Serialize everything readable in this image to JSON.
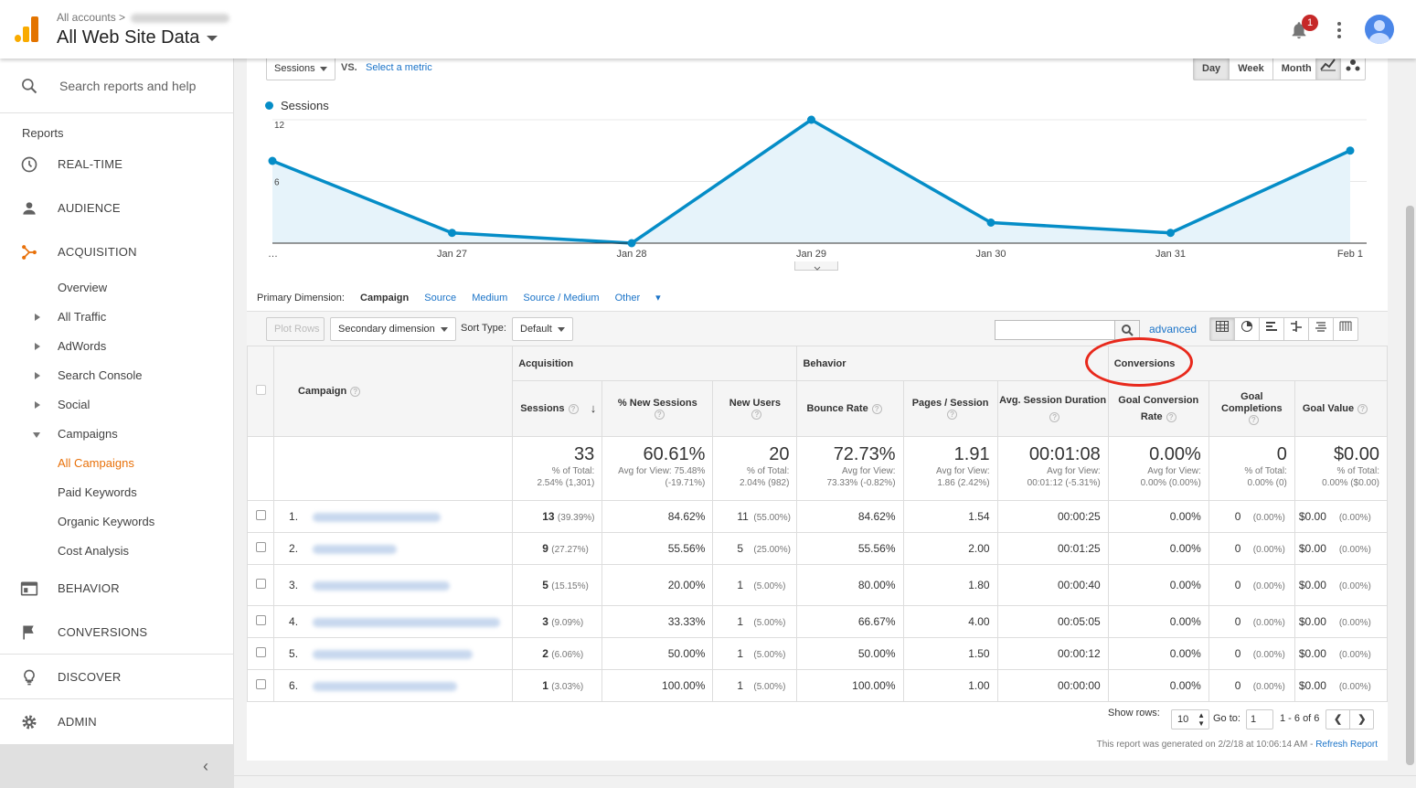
{
  "header": {
    "crumb": "All accounts",
    "view": "All Web Site Data",
    "notifications": "1"
  },
  "sidebar": {
    "search_placeholder": "Search reports and help",
    "reports": "Reports",
    "main": {
      "realtime": "REAL-TIME",
      "audience": "AUDIENCE",
      "acquisition": "ACQUISITION",
      "behavior": "BEHAVIOR",
      "conversions": "CONVERSIONS",
      "discover": "DISCOVER",
      "admin": "ADMIN"
    },
    "sub": {
      "overview": "Overview",
      "all_traffic": "All Traffic",
      "adwords": "AdWords",
      "search_console": "Search Console",
      "social": "Social",
      "campaigns": "Campaigns",
      "all_campaigns": "All Campaigns",
      "paid_keywords": "Paid Keywords",
      "organic_keywords": "Organic Keywords",
      "cost_analysis": "Cost Analysis"
    }
  },
  "controls": {
    "metric": "Sessions",
    "vs": "VS.",
    "select_metric": "Select a metric",
    "day": "Day",
    "week": "Week",
    "month": "Month"
  },
  "chart_data": {
    "type": "area",
    "series": [
      {
        "name": "Sessions",
        "values": [
          8,
          1,
          0,
          12,
          2,
          1,
          9
        ]
      }
    ],
    "x": [
      "…",
      "Jan 27",
      "Jan 28",
      "Jan 29",
      "Jan 30",
      "Jan 31",
      "Feb 1"
    ],
    "yticks": [
      "12",
      "6"
    ],
    "ylim": [
      0,
      12
    ],
    "color": "#058dc7"
  },
  "dims": {
    "label": "Primary Dimension:",
    "campaign": "Campaign",
    "source": "Source",
    "medium": "Medium",
    "source_medium": "Source / Medium",
    "other": "Other"
  },
  "toolbar": {
    "plot_rows": "Plot Rows",
    "secondary": "Secondary dimension",
    "sort_type_label": "Sort Type:",
    "sort_type": "Default",
    "advanced": "advanced"
  },
  "table": {
    "groups": {
      "acquisition": "Acquisition",
      "behavior": "Behavior",
      "conversions": "Conversions"
    },
    "cols": {
      "campaign": "Campaign",
      "sessions": "Sessions",
      "new_sessions": "% New Sessions",
      "new_users": "New Users",
      "bounce": "Bounce Rate",
      "pages": "Pages / Session",
      "duration": "Avg. Session Duration",
      "gcr": "Goal Conversion Rate",
      "gc": "Goal Completions",
      "gv": "Goal Value"
    },
    "totals": [
      {
        "big": "33",
        "sub": "% of Total:",
        "sub2": "2.54% (1,301)"
      },
      {
        "big": "60.61%",
        "sub": "Avg for View: 75.48%",
        "sub2": "(-19.71%)"
      },
      {
        "big": "20",
        "sub": "% of Total:",
        "sub2": "2.04% (982)"
      },
      {
        "big": "72.73%",
        "sub": "Avg for View:",
        "sub2": "73.33% (-0.82%)"
      },
      {
        "big": "1.91",
        "sub": "Avg for View:",
        "sub2": "1.86 (2.42%)"
      },
      {
        "big": "00:01:08",
        "sub": "Avg for View:",
        "sub2": "00:01:12 (-5.31%)"
      },
      {
        "big": "0.00%",
        "sub": "Avg for View:",
        "sub2": "0.00% (0.00%)"
      },
      {
        "big": "0",
        "sub": "% of Total:",
        "sub2": "0.00% (0)"
      },
      {
        "big": "$0.00",
        "sub": "% of Total:",
        "sub2": "0.00% ($0.00)"
      }
    ],
    "rows": [
      {
        "n": "1.",
        "s": "13",
        "sp": "(39.39%)",
        "ns": "84.62%",
        "nu": "11",
        "nup": "(55.00%)",
        "br": "84.62%",
        "ps": "1.54",
        "d": "00:00:25",
        "gcr": "0.00%",
        "gc": "0",
        "gcp": "(0.00%)",
        "gv": "$0.00",
        "gvp": "(0.00%)"
      },
      {
        "n": "2.",
        "s": "9",
        "sp": "(27.27%)",
        "ns": "55.56%",
        "nu": "5",
        "nup": "(25.00%)",
        "br": "55.56%",
        "ps": "2.00",
        "d": "00:01:25",
        "gcr": "0.00%",
        "gc": "0",
        "gcp": "(0.00%)",
        "gv": "$0.00",
        "gvp": "(0.00%)"
      },
      {
        "n": "3.",
        "s": "5",
        "sp": "(15.15%)",
        "ns": "20.00%",
        "nu": "1",
        "nup": "(5.00%)",
        "br": "80.00%",
        "ps": "1.80",
        "d": "00:00:40",
        "gcr": "0.00%",
        "gc": "0",
        "gcp": "(0.00%)",
        "gv": "$0.00",
        "gvp": "(0.00%)"
      },
      {
        "n": "4.",
        "s": "3",
        "sp": "(9.09%)",
        "ns": "33.33%",
        "nu": "1",
        "nup": "(5.00%)",
        "br": "66.67%",
        "ps": "4.00",
        "d": "00:05:05",
        "gcr": "0.00%",
        "gc": "0",
        "gcp": "(0.00%)",
        "gv": "$0.00",
        "gvp": "(0.00%)"
      },
      {
        "n": "5.",
        "s": "2",
        "sp": "(6.06%)",
        "ns": "50.00%",
        "nu": "1",
        "nup": "(5.00%)",
        "br": "50.00%",
        "ps": "1.50",
        "d": "00:00:12",
        "gcr": "0.00%",
        "gc": "0",
        "gcp": "(0.00%)",
        "gv": "$0.00",
        "gvp": "(0.00%)"
      },
      {
        "n": "6.",
        "s": "1",
        "sp": "(3.03%)",
        "ns": "100.00%",
        "nu": "1",
        "nup": "(5.00%)",
        "br": "100.00%",
        "ps": "1.00",
        "d": "00:00:00",
        "gcr": "0.00%",
        "gc": "0",
        "gcp": "(0.00%)",
        "gv": "$0.00",
        "gvp": "(0.00%)"
      }
    ]
  },
  "pager": {
    "show_rows": "Show rows:",
    "rows": "10",
    "goto": "Go to:",
    "page": "1",
    "range": "1 - 6 of 6"
  },
  "footer": {
    "generated": "This report was generated on 2/2/18 at 10:06:14 AM - ",
    "refresh": "Refresh Report"
  }
}
